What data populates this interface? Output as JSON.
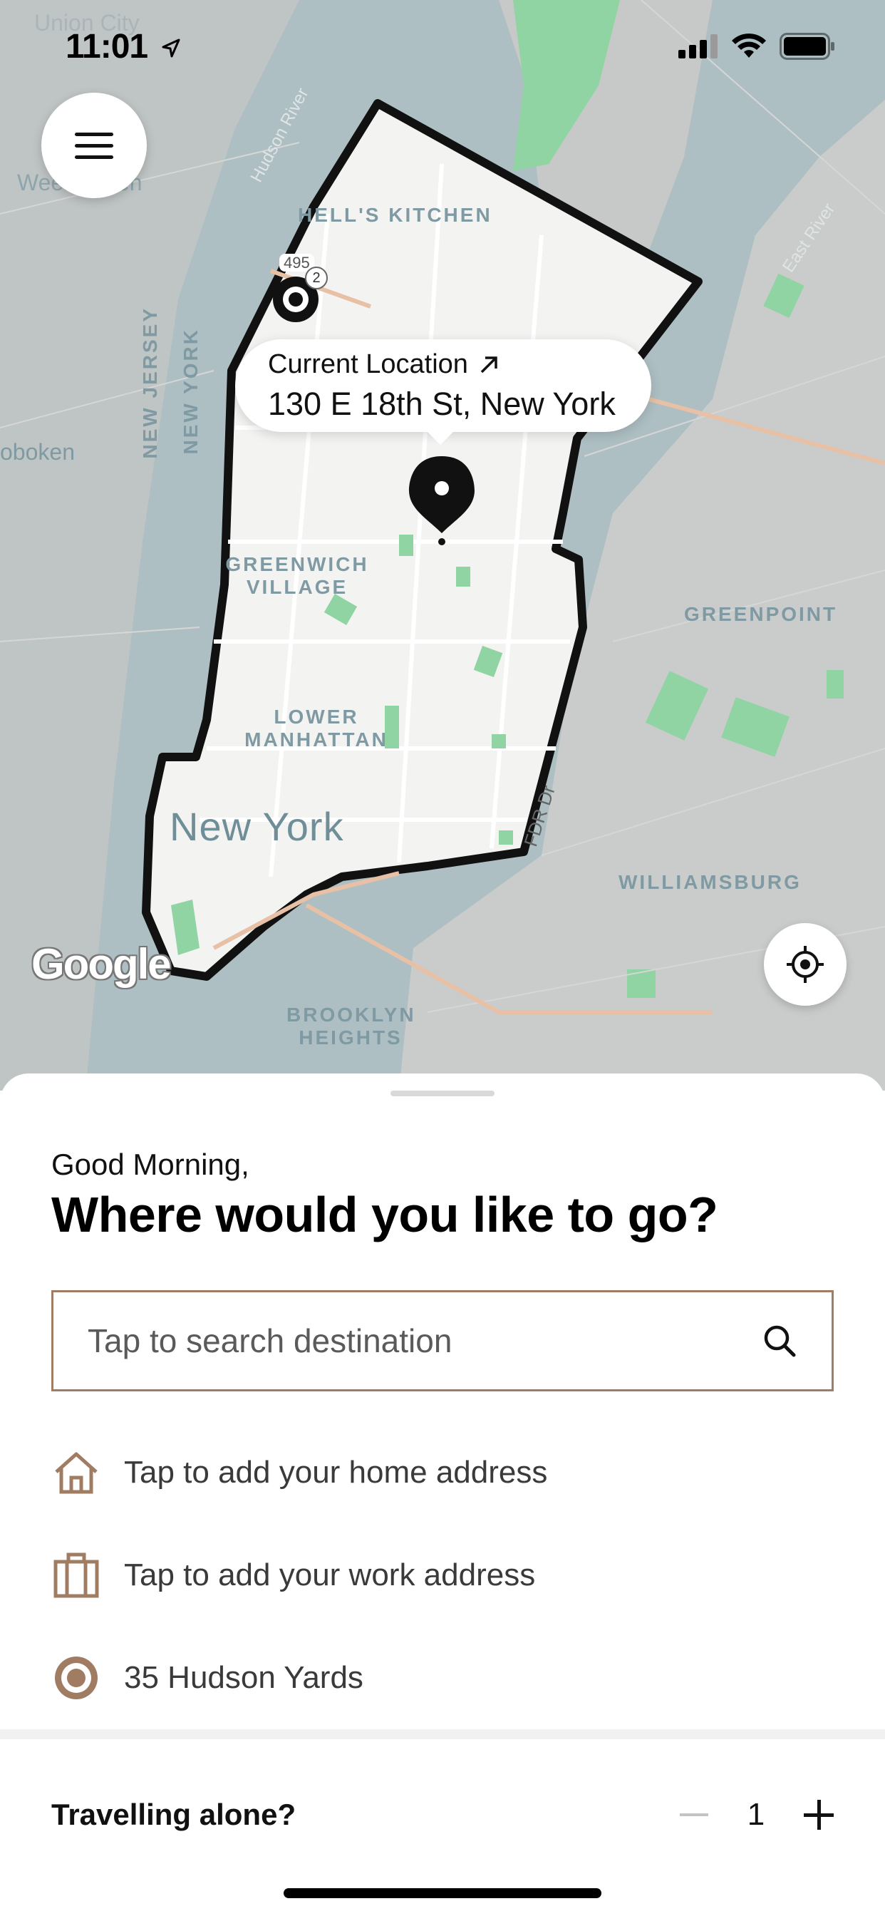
{
  "status_bar": {
    "time": "11:01"
  },
  "map": {
    "labels": {
      "union_city": "Union City",
      "weehawken": "Weehawken",
      "hudson_river": "Hudson River",
      "hells_kitchen": "HELL'S KITCHEN",
      "new_jersey": "NEW JERSEY",
      "new_york_state": "NEW YORK",
      "hoboken": "oboken",
      "greenwich_village": "GREENWICH VILLAGE",
      "lower_manhattan": "LOWER MANHATTAN",
      "new_york_city": "New York",
      "greenpoint": "GREENPOINT",
      "williamsburg": "WILLIAMSBURG",
      "brooklyn_heights": "BROOKLYN HEIGHTS",
      "east_river": "East River",
      "fdr_dr": "FDR Dr",
      "route_495": "495",
      "marker_badge": "2"
    },
    "current_location": {
      "title": "Current Location",
      "address": "130 E 18th St, New York"
    },
    "attribution": "Google"
  },
  "sheet": {
    "greeting": "Good Morning,",
    "headline": "Where would you like to go?",
    "search": {
      "placeholder": "Tap to search destination"
    },
    "places": [
      {
        "icon": "home-icon",
        "label": "Tap to add your home address"
      },
      {
        "icon": "briefcase-icon",
        "label": "Tap to add your work address"
      },
      {
        "icon": "target-icon",
        "label": "35 Hudson Yards"
      }
    ],
    "travel": {
      "label": "Travelling alone?",
      "count": "1"
    }
  },
  "colors": {
    "accent_brown": "#a07c63",
    "map_water": "#aebfc3",
    "map_land": "#e8e9e7",
    "park_green": "#8fd4a2"
  }
}
